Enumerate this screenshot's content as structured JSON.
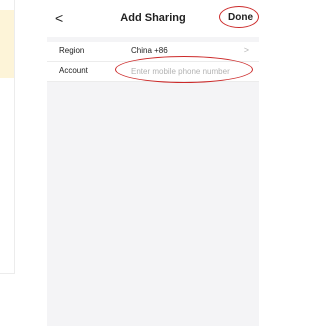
{
  "nav": {
    "back_glyph": "<",
    "title": "Add Sharing",
    "done_label": "Done"
  },
  "form": {
    "region_label": "Region",
    "region_value": "China +86",
    "region_chevron": ">",
    "account_label": "Account",
    "account_placeholder": "Enter mobile phone number",
    "account_value": ""
  },
  "annotations": {
    "highlight_color": "#cc2a2a"
  },
  "icons": {
    "back": "back-arrow-icon",
    "chevron": "chevron-right-icon"
  }
}
